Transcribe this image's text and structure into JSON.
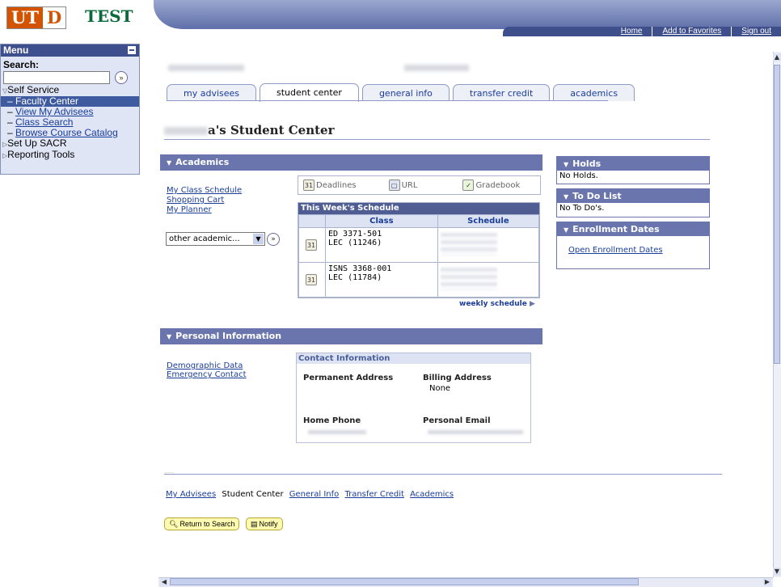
{
  "header": {
    "logo_u": "UT",
    "logo_d": "D",
    "env_label": "TEST",
    "links": [
      "Home",
      "Add to Favorites",
      "Sign out"
    ]
  },
  "menu": {
    "title": "Menu",
    "search_label": "Search:",
    "search_value": "",
    "search_go": "»",
    "self_service": "Self Service",
    "items": [
      "Faculty Center",
      "View My Advisees",
      "Class Search",
      "Browse Course Catalog"
    ],
    "setup": "Set Up SACR",
    "reporting": "Reporting Tools"
  },
  "tabs": [
    "my advisees",
    "student center",
    "general info",
    "transfer credit",
    "academics"
  ],
  "active_tab": "student center",
  "page_title_suffix": "a's Student Center",
  "academics": {
    "header": "Academics",
    "links": [
      "My Class Schedule",
      "Shopping Cart",
      "My Planner"
    ],
    "other_select": "other academic...",
    "go": "»",
    "deadlines": "Deadlines",
    "url": "URL",
    "gradebook": "Gradebook",
    "schedule_title": "This Week's Schedule",
    "col_class": "Class",
    "col_schedule": "Schedule",
    "rows": [
      {
        "line1": "ED 3371-501",
        "line2": "LEC (11246)"
      },
      {
        "line1": "ISNS 3368-001",
        "line2": "LEC (11784)"
      }
    ],
    "weekly_link": "weekly schedule"
  },
  "holds": {
    "header": "Holds",
    "body": "No Holds."
  },
  "todo": {
    "header": "To Do List",
    "body": "No To Do's."
  },
  "enrollment": {
    "header": "Enrollment Dates",
    "link": "Open Enrollment Dates"
  },
  "personal": {
    "header": "Personal Information",
    "links": [
      "Demographic Data",
      "Emergency Contact"
    ],
    "contact_title": "Contact Information",
    "permanent_address": "Permanent Address",
    "billing_address": "Billing Address",
    "billing_value": "None",
    "home_phone": "Home Phone",
    "personal_email": "Personal Email"
  },
  "footer": {
    "links": [
      "My Advisees",
      "Student Center",
      "General Info",
      "Transfer Credit",
      "Academics"
    ],
    "return_btn": "Return to Search",
    "notify_btn": "Notify"
  },
  "colors": {
    "section_header": "#6a75ad",
    "menu_head": "#3e4f8e",
    "link": "#1a3d9a",
    "logo": "#d35400",
    "test": "#0a6b3a"
  }
}
